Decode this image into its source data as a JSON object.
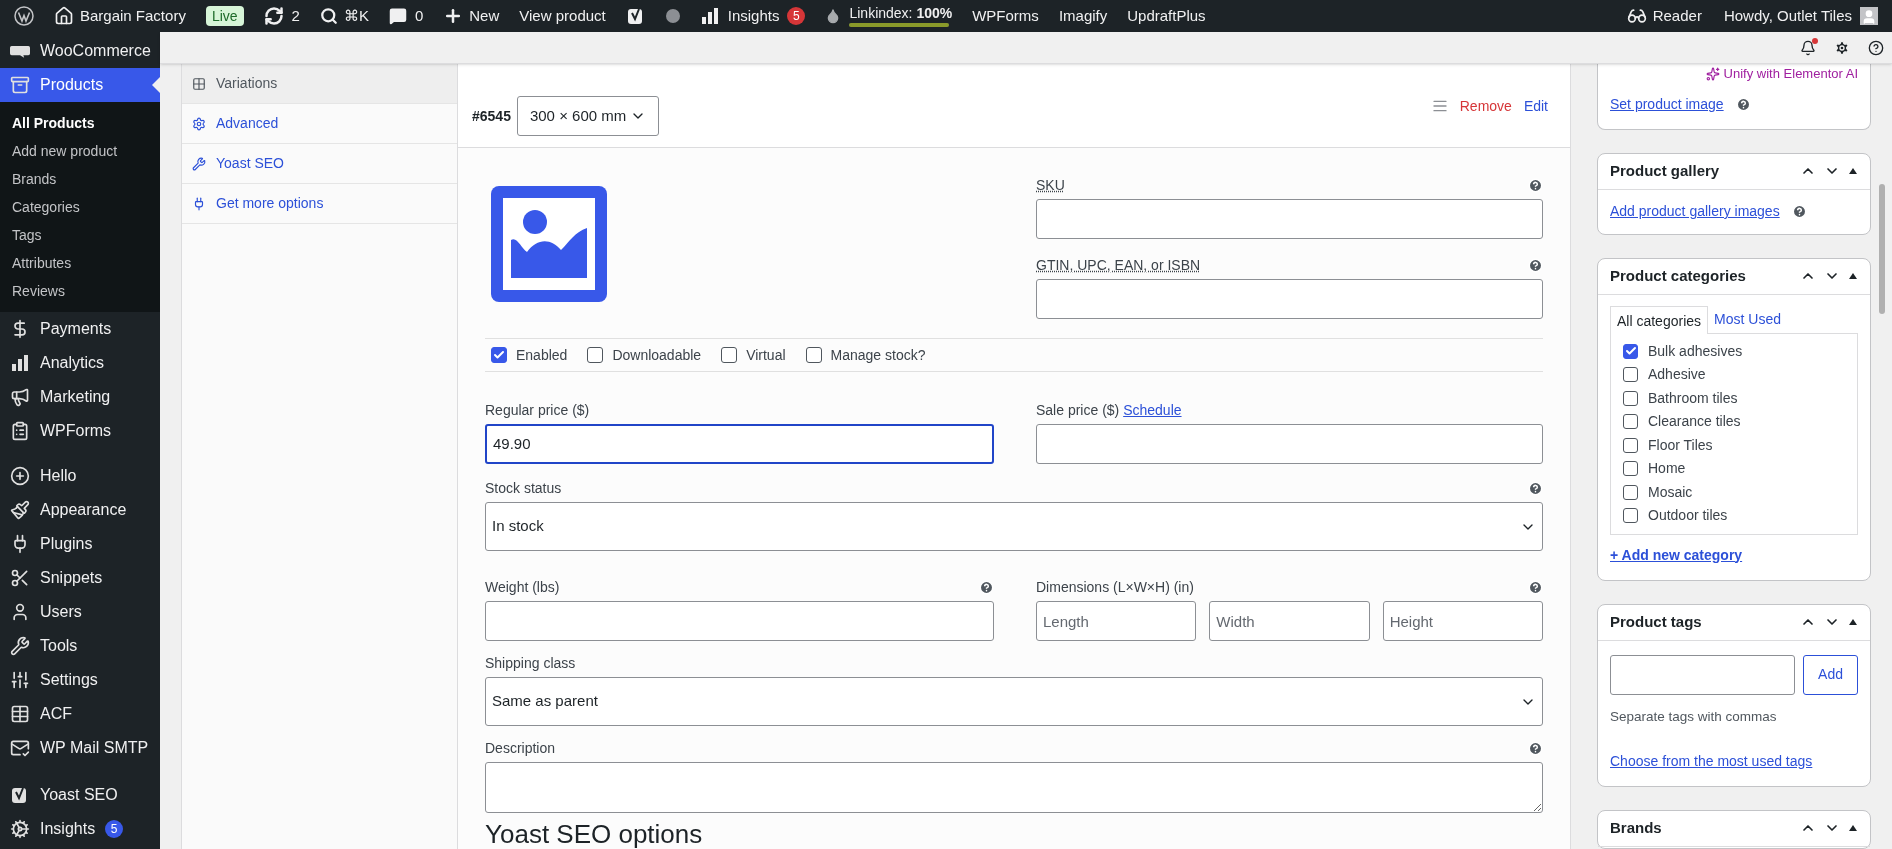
{
  "admin_bar": {
    "left": [
      {
        "kind": "logo"
      },
      {
        "kind": "site",
        "label": "Bargain Factory"
      },
      {
        "kind": "badge",
        "label": "Live"
      },
      {
        "kind": "updates",
        "label": "2"
      },
      {
        "kind": "search",
        "label": "⌘K"
      },
      {
        "kind": "comments",
        "label": "0"
      },
      {
        "kind": "new",
        "label": "New"
      },
      {
        "kind": "text",
        "label": "View product"
      },
      {
        "kind": "yoast"
      },
      {
        "kind": "dot"
      },
      {
        "kind": "insights",
        "label": "Insights",
        "count": "5"
      },
      {
        "kind": "linkindex",
        "label": "Linkindex:",
        "value": "100%",
        "level": 1
      },
      {
        "kind": "text",
        "label": "WPForms"
      },
      {
        "kind": "text",
        "label": "Imagify"
      },
      {
        "kind": "text",
        "label": "UpdraftPlus"
      }
    ],
    "right": [
      {
        "kind": "reader",
        "label": "Reader"
      },
      {
        "kind": "account",
        "label": "Howdy, Outlet Tiles"
      }
    ]
  },
  "sidebar": {
    "sections": [
      [
        {
          "label": "WooCommerce",
          "selected": false
        },
        {
          "label": "Products",
          "selected": true,
          "children": [
            {
              "label": "All Products",
              "selected": true
            },
            {
              "label": "Add new product",
              "selected": false
            },
            {
              "label": "Brands",
              "selected": false
            },
            {
              "label": "Categories",
              "selected": false
            },
            {
              "label": "Tags",
              "selected": false
            },
            {
              "label": "Attributes",
              "selected": false
            },
            {
              "label": "Reviews",
              "selected": false
            }
          ]
        },
        {
          "label": "Payments",
          "selected": false
        },
        {
          "label": "Analytics",
          "selected": false
        },
        {
          "label": "Marketing",
          "selected": false
        },
        {
          "label": "WPForms",
          "selected": false
        }
      ],
      [
        {
          "label": "Hello",
          "selected": false
        },
        {
          "label": "Appearance",
          "selected": false
        },
        {
          "label": "Plugins",
          "selected": false
        },
        {
          "label": "Snippets",
          "selected": false
        },
        {
          "label": "Users",
          "selected": false
        },
        {
          "label": "Tools",
          "selected": false
        },
        {
          "label": "Settings",
          "selected": false
        },
        {
          "label": "ACF",
          "selected": false
        },
        {
          "label": "WP Mail SMTP",
          "selected": false
        }
      ],
      [
        {
          "label": "Yoast SEO",
          "selected": false
        },
        {
          "label": "Insights",
          "selected": false,
          "count": "5"
        }
      ]
    ]
  },
  "product_data_tabs": [
    {
      "label": "Variations",
      "selected": true
    },
    {
      "label": "Advanced",
      "selected": false
    },
    {
      "label": "Yoast SEO",
      "selected": false
    },
    {
      "label": "Get more options",
      "selected": false
    }
  ],
  "variation": {
    "id": "#6545",
    "attribute": "300 × 600 mm",
    "actions": {
      "remove": "Remove",
      "edit": "Edit"
    },
    "sku": {
      "label": "SKU"
    },
    "gtin": {
      "label": "GTIN, UPC, EAN, or ISBN"
    },
    "options": [
      {
        "label": "Enabled",
        "checked": true
      },
      {
        "label": "Downloadable",
        "checked": false
      },
      {
        "label": "Virtual",
        "checked": false
      },
      {
        "label": "Manage stock?",
        "checked": false
      }
    ],
    "regular_price": {
      "label": "Regular price ($)",
      "value": "49.90",
      "focused": true
    },
    "sale_price": {
      "label": "Sale price ($)",
      "link": "Schedule"
    },
    "stock_status": {
      "label": "Stock status",
      "value": "In stock"
    },
    "weight": {
      "label": "Weight (lbs)"
    },
    "dimensions": {
      "label": "Dimensions (L×W×H) (in)",
      "placeholders": [
        "Length",
        "Width",
        "Height"
      ]
    },
    "shipping_class": {
      "label": "Shipping class",
      "value": "Same as parent"
    },
    "description": {
      "label": "Description"
    }
  },
  "yoast_heading": "Yoast SEO options",
  "right_column": {
    "product_image": {
      "ai_link": "Unify with Elementor AI",
      "link": "Set product image"
    },
    "product_gallery": {
      "title": "Product gallery",
      "link": "Add product gallery images"
    },
    "product_categories": {
      "title": "Product categories",
      "tabs": [
        {
          "label": "All categories",
          "selected": true
        },
        {
          "label": "Most Used",
          "selected": false
        }
      ],
      "items": [
        {
          "label": "Bulk adhesives",
          "checked": true
        },
        {
          "label": "Adhesive",
          "checked": false
        },
        {
          "label": "Bathroom tiles",
          "checked": false
        },
        {
          "label": "Clearance tiles",
          "checked": false
        },
        {
          "label": "Floor Tiles",
          "checked": false
        },
        {
          "label": "Home",
          "checked": false
        },
        {
          "label": "Mosaic",
          "checked": false
        },
        {
          "label": "Outdoor tiles",
          "checked": false
        }
      ],
      "add_link": "+ Add new category"
    },
    "product_tags": {
      "title": "Product tags",
      "button": "Add",
      "hint": "Separate tags with commas",
      "link": "Choose from the most used tags"
    },
    "brands": {
      "title": "Brands"
    }
  }
}
